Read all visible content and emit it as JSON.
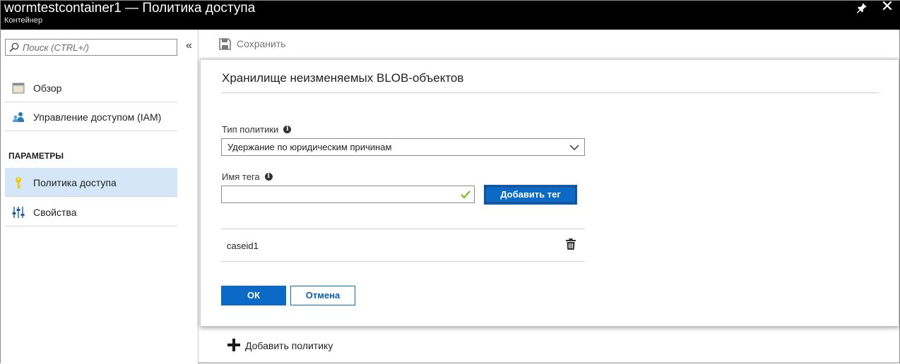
{
  "window": {
    "title": "wormtestcontainer1 — Политика доступа",
    "subtitle": "Контейнер"
  },
  "search": {
    "placeholder": "Поиск (CTRL+/)"
  },
  "sidebar": {
    "items": [
      {
        "label": "Обзор",
        "icon": "overview-icon"
      },
      {
        "label": "Управление доступом (IAM)",
        "icon": "iam-icon"
      }
    ],
    "section_header": "ПАРАМЕТРЫ",
    "settings_items": [
      {
        "label": "Политика доступа",
        "icon": "key-icon",
        "selected": true
      },
      {
        "label": "Свойства",
        "icon": "properties-icon"
      }
    ]
  },
  "toolbar": {
    "save_label": "Сохранить"
  },
  "dialog": {
    "heading": "Хранилище неизменяемых BLOB-объектов",
    "policy_type_label": "Тип политики",
    "policy_type_value": "Удержание по юридическим причинам",
    "tag_name_label": "Имя тега",
    "tag_name_value": "",
    "add_tag_label": "Добавить тег",
    "tags": [
      {
        "name": "caseid1"
      }
    ],
    "ok_label": "ОК",
    "cancel_label": "Отмена"
  },
  "add_policy_label": "Добавить политику",
  "colors": {
    "accent": "#0a6ac6",
    "selected_bg": "#d4e6f7",
    "titlebar_bg": "#000000",
    "valid_check": "#6bb700"
  }
}
